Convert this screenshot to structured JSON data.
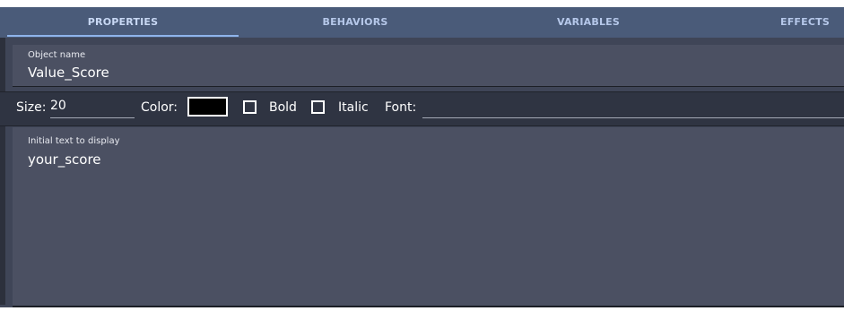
{
  "tabs": [
    {
      "label": "PROPERTIES",
      "active": true
    },
    {
      "label": "BEHAVIORS",
      "active": false
    },
    {
      "label": "VARIABLES",
      "active": false
    },
    {
      "label": "EFFECTS",
      "active": false
    }
  ],
  "object_name": {
    "label": "Object name",
    "value": "Value_Score"
  },
  "toolbar": {
    "size_label": "Size:",
    "size_value": "20",
    "color_label": "Color:",
    "color_value": "#000000",
    "bold_label": "Bold",
    "bold_checked": false,
    "italic_label": "Italic",
    "italic_checked": false,
    "font_label": "Font:",
    "font_value": ""
  },
  "initial_text": {
    "label": "Initial text to display",
    "value": "your_score"
  },
  "colors": {
    "tab_bar": "#4a5b79",
    "panel": "#3f4557",
    "field": "#4b5062",
    "toolbar": "#2f3442",
    "accent": "#8fb4ea"
  }
}
